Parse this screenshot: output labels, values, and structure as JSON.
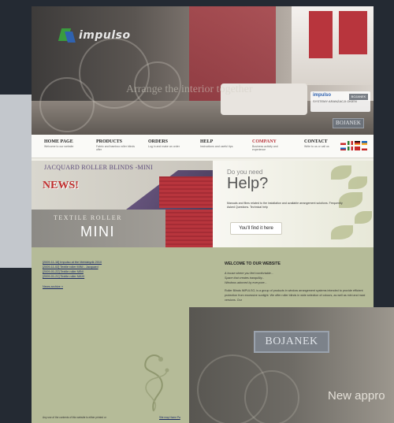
{
  "hero": {
    "logo_text": "impulso",
    "tagline": "Arrange the interior together",
    "brand_small_logo": "impulso",
    "brand_small_sub": "SYSTEMY ARANŻACJI OKIEN",
    "brand_small_badge": "BOJANEK",
    "bojanek_small": "BOJANEK"
  },
  "nav": {
    "items": [
      {
        "title": "HOME PAGE",
        "sub": "Welcome to our website"
      },
      {
        "title": "PRODUCTS",
        "sub": "Fabric and bamboo roller blinds offer"
      },
      {
        "title": "ORDERS",
        "sub": "Log in and make an order"
      },
      {
        "title": "HELP",
        "sub": "Instructions and useful tips"
      },
      {
        "title": "COMPANY",
        "sub": "Business activity and experience"
      },
      {
        "title": "CONTACT",
        "sub": "Write to us or call us"
      }
    ],
    "flag_colors": [
      "#c62828",
      "#ffffff",
      "#c62828",
      "#2e7d32",
      "#1565c0",
      "#f9a825",
      "#c62828",
      "#ffffff"
    ]
  },
  "banners": {
    "jacquard_title": "JACQUARD ROLLER BLINDS -MINI",
    "news_badge": "NEWS!",
    "textile_title": "TEXTILE ROLLER",
    "textile_mini": "MINI"
  },
  "help": {
    "need": "Do you need",
    "big": "Help?",
    "desc": "Manuals and films related to the installation and available arrangement solutions. Frequently Asked Questions. Technical help",
    "button": "You'll find it here"
  },
  "news": {
    "items": [
      "[2009-11-16] Impulso at the Meblabydk 2010",
      "[2009-11-02] Textile roller MINI - Jacquard",
      "[2009-01-22] Textile roller MINI",
      "[2009-01-21] Textile roller MAXI"
    ],
    "archive": "News archive »"
  },
  "welcome": {
    "title": "WELCOME TO OUR WEBSITE",
    "lines": [
      "A house where you feel comfortable...",
      "Space that creates tranquility...",
      "Windows adorned by everyone..."
    ],
    "body": "Roller Blinds IMPULSO, is a group of products in window arrangement systems intended to provide efficient protection from excessive sunlight. We offer roller blinds in wide selection of colours, as well as mini and maxi versions. Our"
  },
  "footer": {
    "text": "Any use of the contents of this website is either printed or",
    "links": "Site map   Home Pa"
  },
  "overlay": {
    "bojanek": "BOJANEK",
    "tag": "New appro"
  }
}
